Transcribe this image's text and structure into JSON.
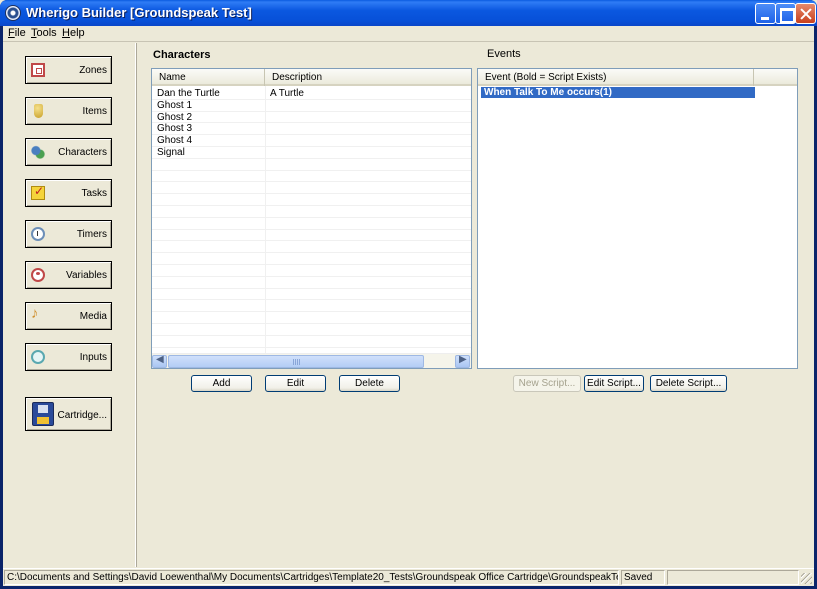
{
  "window": {
    "title": "Wherigo Builder [Groundspeak Test]"
  },
  "menu": [
    {
      "label": "File",
      "accel": "F",
      "rest": "ile"
    },
    {
      "label": "Tools",
      "accel": "T",
      "rest": "ools"
    },
    {
      "label": "Help",
      "accel": "H",
      "rest": "elp"
    }
  ],
  "sidebar": {
    "items": [
      {
        "label": "Zones",
        "icon": "zone-icon"
      },
      {
        "label": "Items",
        "icon": "item-icon"
      },
      {
        "label": "Characters",
        "icon": "character-icon"
      },
      {
        "label": "Tasks",
        "icon": "task-icon"
      },
      {
        "label": "Timers",
        "icon": "timer-icon"
      },
      {
        "label": "Variables",
        "icon": "variable-icon"
      },
      {
        "label": "Media",
        "icon": "media-icon"
      },
      {
        "label": "Inputs",
        "icon": "input-icon"
      }
    ],
    "cartridge_label": "Cartridge..."
  },
  "characters": {
    "title": "Characters",
    "columns": [
      "Name",
      "Description"
    ],
    "rows": [
      {
        "name": "Dan the Turtle",
        "description": "A Turtle"
      },
      {
        "name": "Ghost 1",
        "description": ""
      },
      {
        "name": "Ghost 2",
        "description": ""
      },
      {
        "name": "Ghost 3",
        "description": ""
      },
      {
        "name": "Ghost 4",
        "description": ""
      },
      {
        "name": "Signal",
        "description": ""
      }
    ],
    "buttons": {
      "add": "Add",
      "edit": "Edit",
      "delete": "Delete"
    },
    "scroll_grip": "III"
  },
  "events": {
    "title": "Events",
    "column": "Event (Bold = Script Exists)",
    "selected": "When Talk To Me occurs(1)",
    "buttons": {
      "new": "New Script...",
      "edit": "Edit Script...",
      "delete": "Delete Script..."
    }
  },
  "status": {
    "path": "C:\\Documents and Settings\\David Loewenthal\\My Documents\\Cartridges\\Template20_Tests\\Groundspeak Office Cartridge\\GroundspeakTes",
    "state": "Saved"
  },
  "colors": {
    "title_blue": "#0a5be0",
    "selection": "#316ac5",
    "face": "#ece9d8"
  }
}
